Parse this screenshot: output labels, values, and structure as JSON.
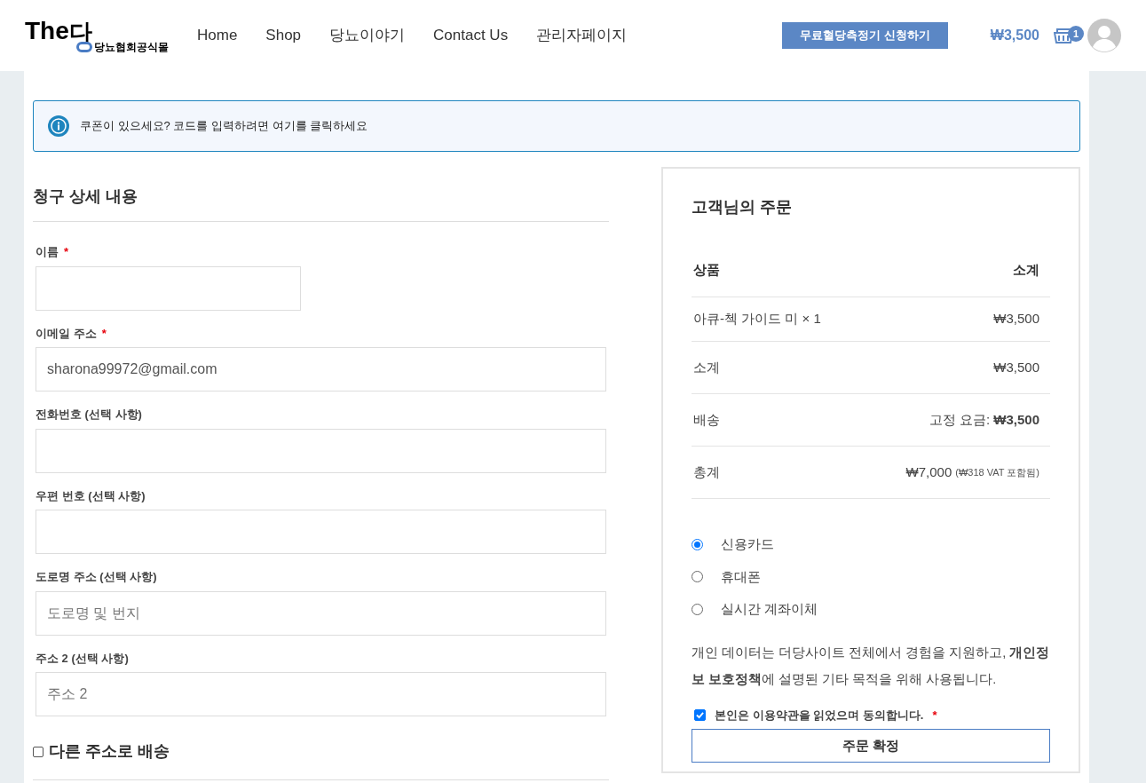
{
  "header": {
    "logo": {
      "main": "The",
      "accent": "다",
      "sub": "당뇨협회공식몰"
    },
    "nav": [
      {
        "label": "Home"
      },
      {
        "label": "Shop"
      },
      {
        "label": "당뇨이야기"
      },
      {
        "label": "Contact Us"
      },
      {
        "label": "관리자페이지"
      }
    ],
    "cta": "무료혈당측정기 신청하기",
    "cart_total": "₩3,500",
    "cart_count": "1"
  },
  "coupon_notice": "쿠폰이 있으세요? 코드를 입력하려면 여기를 클릭하세요",
  "billing": {
    "title": "청구 상세 내용",
    "fields": [
      {
        "label": "이름",
        "required_mark": "*",
        "kind": "half"
      },
      {
        "label": "이메일 주소",
        "required_mark": "*",
        "kind": "full",
        "value": "sharona99972@gmail.com"
      },
      {
        "label": "전화번호 (선택 사항)",
        "kind": "full"
      },
      {
        "label": "우편 번호 (선택 사항)",
        "kind": "full"
      },
      {
        "label": "도로명 주소 (선택 사항)",
        "kind": "full",
        "placeholder": "도로명 및 번지"
      },
      {
        "label": "주소 2 (선택 사항)",
        "kind": "full",
        "placeholder": "주소 2"
      }
    ],
    "ship_other": {
      "label": "다른 주소로 배송",
      "checked": false
    }
  },
  "order": {
    "title": "고객님의 주문",
    "columns": [
      "상품",
      "소계"
    ],
    "rows": [
      {
        "kind": "item",
        "label": "아큐-첵 가이드 미 × 1",
        "value": "₩3,500"
      },
      {
        "kind": "subtotal",
        "label": "소계",
        "value": "₩3,500"
      },
      {
        "kind": "shipping",
        "label": "배송",
        "method": "고정 요금:",
        "value": "₩3,500"
      },
      {
        "kind": "total",
        "label": "총계",
        "value": "₩7,000",
        "note": "(₩318 VAT 포함됨)"
      }
    ],
    "payment_methods": [
      {
        "label": "신용카드",
        "selected": true
      },
      {
        "label": "휴대폰",
        "selected": false
      },
      {
        "label": "실시간 계좌이체",
        "selected": false
      }
    ],
    "privacy": "개인 데이터는 더당사이트 전체에서 경험을 지원하고, **개인정보 보호정책**에 설명된 기타 목적을 위해 사용됩니다.",
    "terms": {
      "label": "본인은 이용약관을 읽었으며 동의합니다.",
      "checked": true,
      "required_mark": "*"
    },
    "submit": "주문 확정"
  }
}
